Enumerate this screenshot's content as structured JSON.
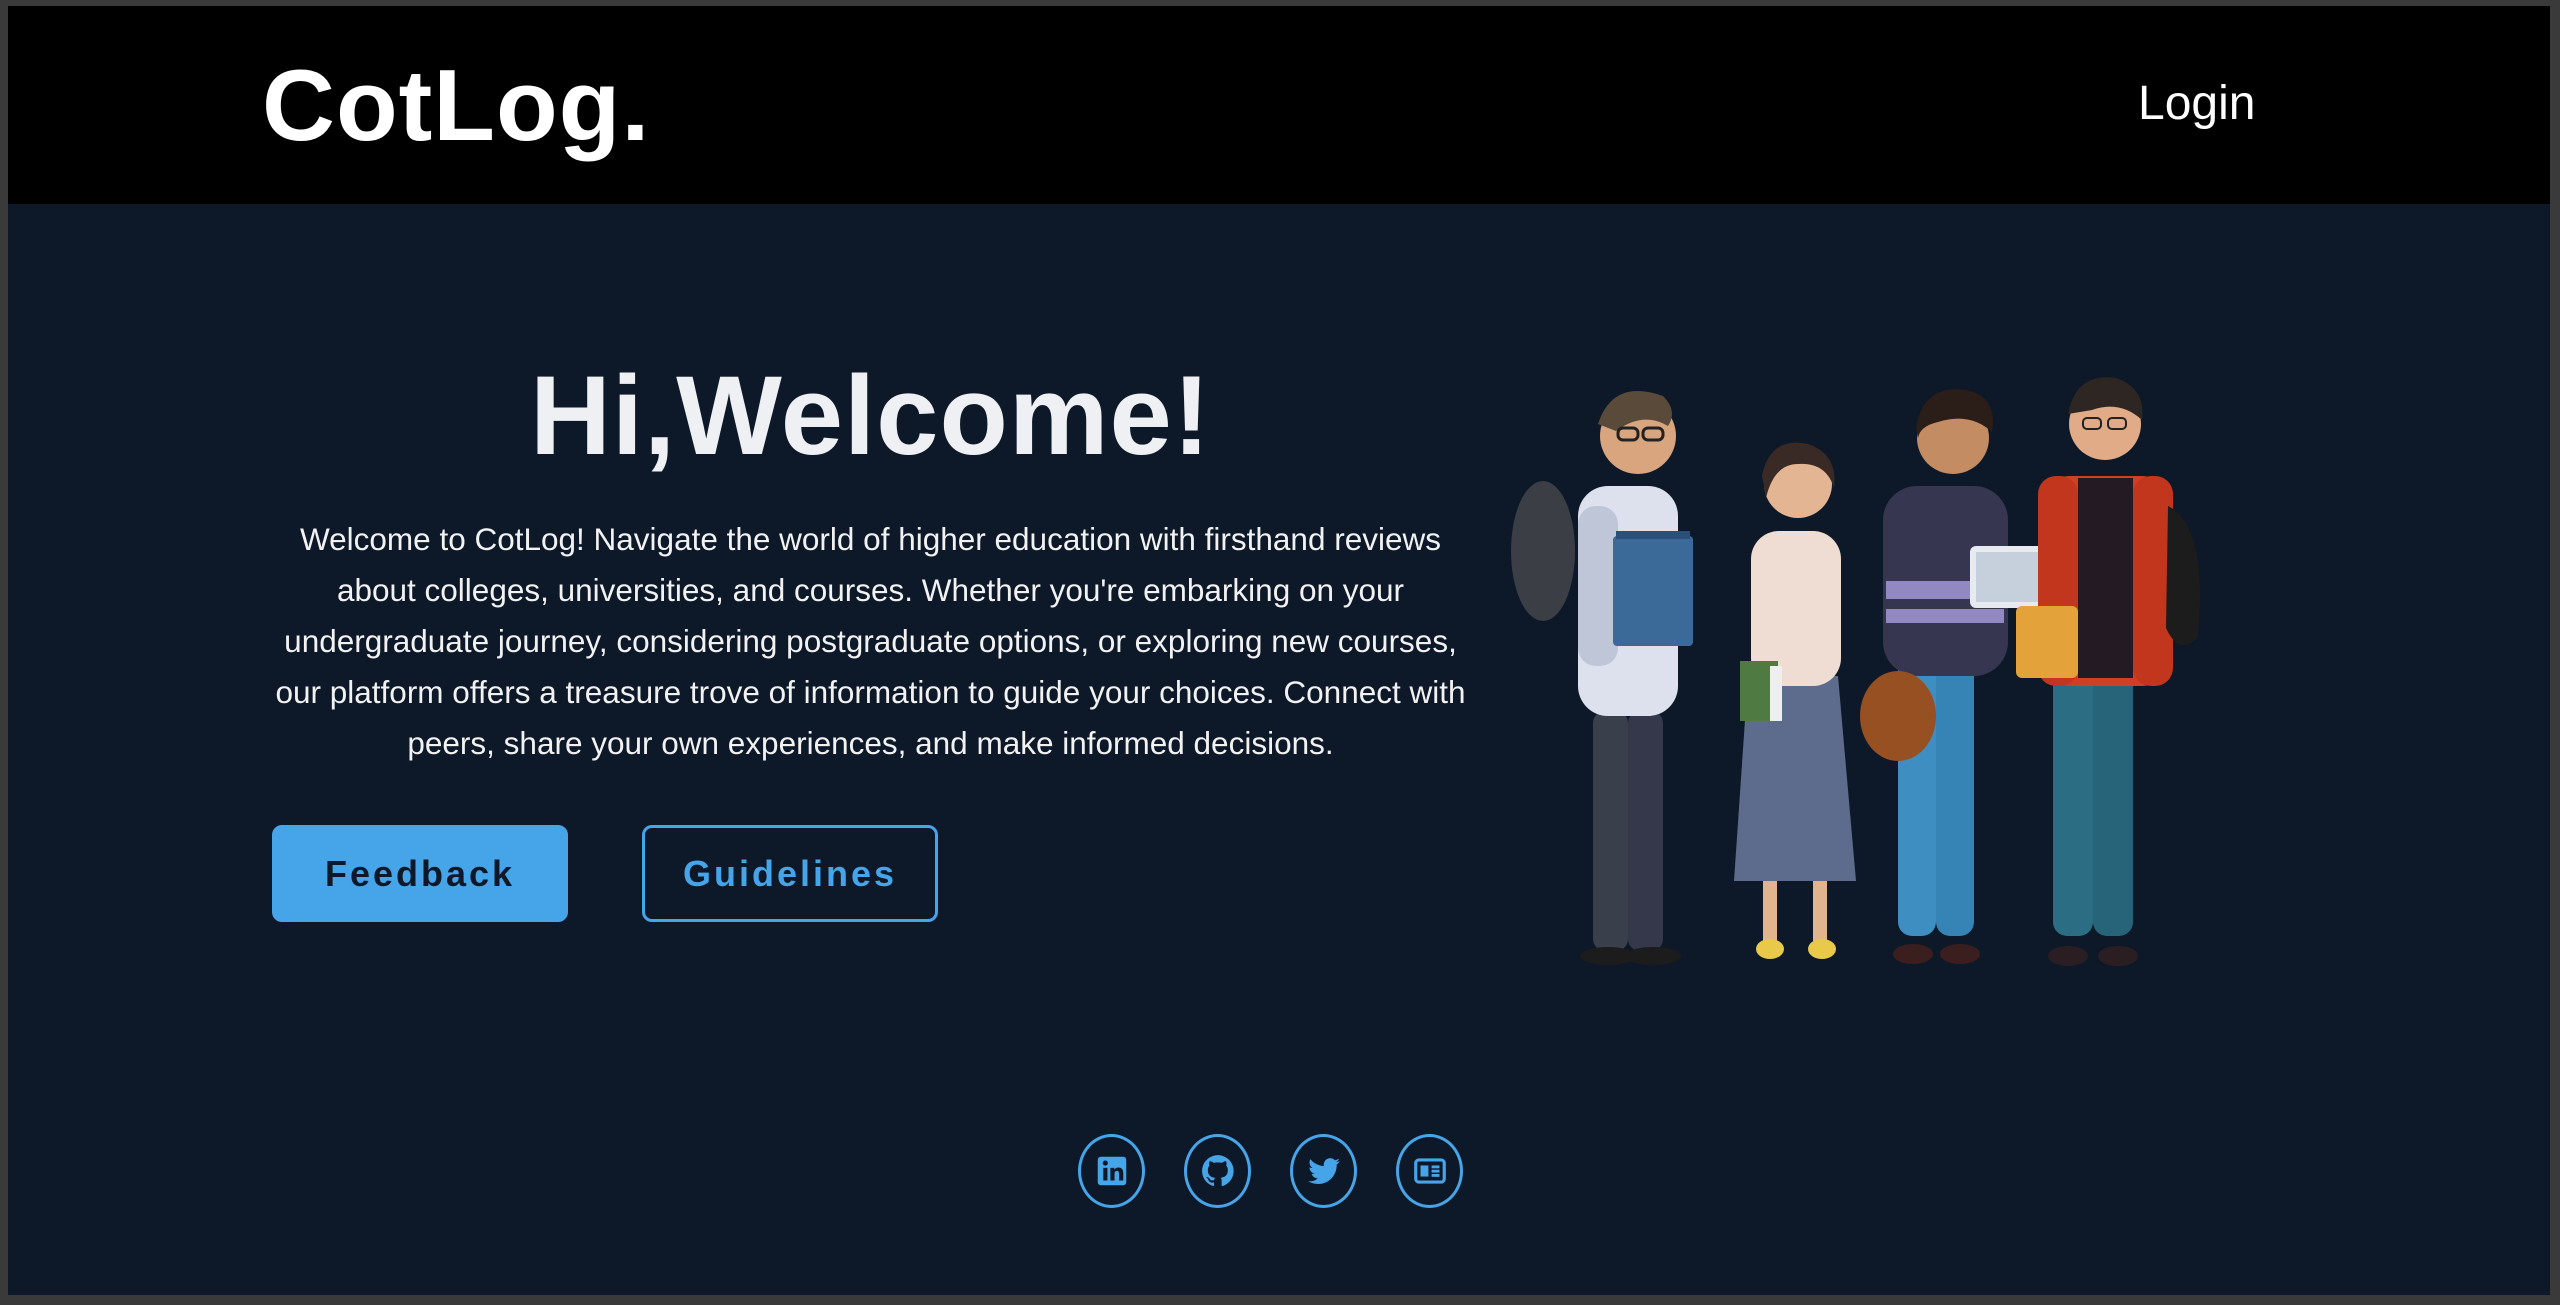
{
  "header": {
    "logo": "CotLog.",
    "login_label": "Login"
  },
  "hero": {
    "title": "Hi,Welcome!",
    "description": "Welcome to CotLog! Navigate the world of higher education with firsthand reviews about colleges, universities, and courses. Whether you're embarking on your undergraduate journey, considering postgraduate options, or exploring new courses, our platform offers a treasure trove of information to guide your choices. Connect with peers, share your own experiences, and make informed decisions.",
    "feedback_label": "Feedback",
    "guidelines_label": "Guidelines",
    "illustration": "group-of-students-illustration"
  },
  "footer": {
    "social_icons": [
      "linkedin-icon",
      "github-icon",
      "twitter-icon",
      "blog-icon"
    ]
  },
  "colors": {
    "background": "#0d1928",
    "navbar": "#000000",
    "accent": "#46a4e8",
    "text": "#ffffff"
  }
}
